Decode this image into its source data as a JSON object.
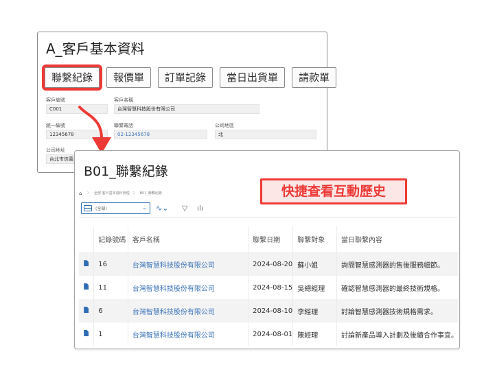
{
  "window_a": {
    "title": "A_客戶基本資料",
    "tabs": [
      "聯繫紀錄",
      "報價單",
      "訂單記錄",
      "當日出貨單",
      "請款單"
    ],
    "fields": {
      "customer_no_label": "客戶編號",
      "customer_no": "C001",
      "customer_name_label": "客戶名稱",
      "customer_name": "台灣智慧科技股份有限公司",
      "tax_id_label": "統一編號",
      "tax_id": "12345678",
      "phone_label": "聯繫電話",
      "phone": "02-12345678",
      "region_label": "公司地區",
      "region": "北",
      "address_label": "公司地址",
      "address": "台北市信義"
    }
  },
  "window_b": {
    "title": "B01_聯繫紀錄",
    "breadcrumb": [
      "全部 客戶基本資料管理",
      "B01_聯繫紀錄"
    ],
    "callout": "快捷查看互動歷史",
    "view_select": "(全部)",
    "columns": [
      "記錄號碼",
      "客戶名稱",
      "聯繫日期",
      "聯繫對象",
      "當日聯繫內容"
    ],
    "rows": [
      {
        "id": "16",
        "customer": "台灣智慧科技股份有限公司",
        "date": "2024-08-20",
        "contact": "蘇小姐",
        "content": "詢問智慧感測器的售後服務細節。"
      },
      {
        "id": "11",
        "customer": "台灣智慧科技股份有限公司",
        "date": "2024-08-15",
        "contact": "吳總經理",
        "content": "確認智慧感測器的最終技術規格。"
      },
      {
        "id": "6",
        "customer": "台灣智慧科技股份有限公司",
        "date": "2024-08-10",
        "contact": "李經理",
        "content": "討論智慧感測器技術規格需求。"
      },
      {
        "id": "1",
        "customer": "台灣智慧科技股份有限公司",
        "date": "2024-08-01",
        "contact": "陳經理",
        "content": "討論新產品導入計劃及後續合作事宜。"
      }
    ]
  },
  "colors": {
    "accent_red": "#ee3a36",
    "link_blue": "#3b73b9",
    "brand_blue": "#2f6eb5"
  },
  "icons": [
    "home-icon",
    "grid-icon",
    "chevron-down-icon",
    "chart-line-icon",
    "filter-icon",
    "bar-chart-icon",
    "document-icon",
    "curved-arrow-icon"
  ]
}
